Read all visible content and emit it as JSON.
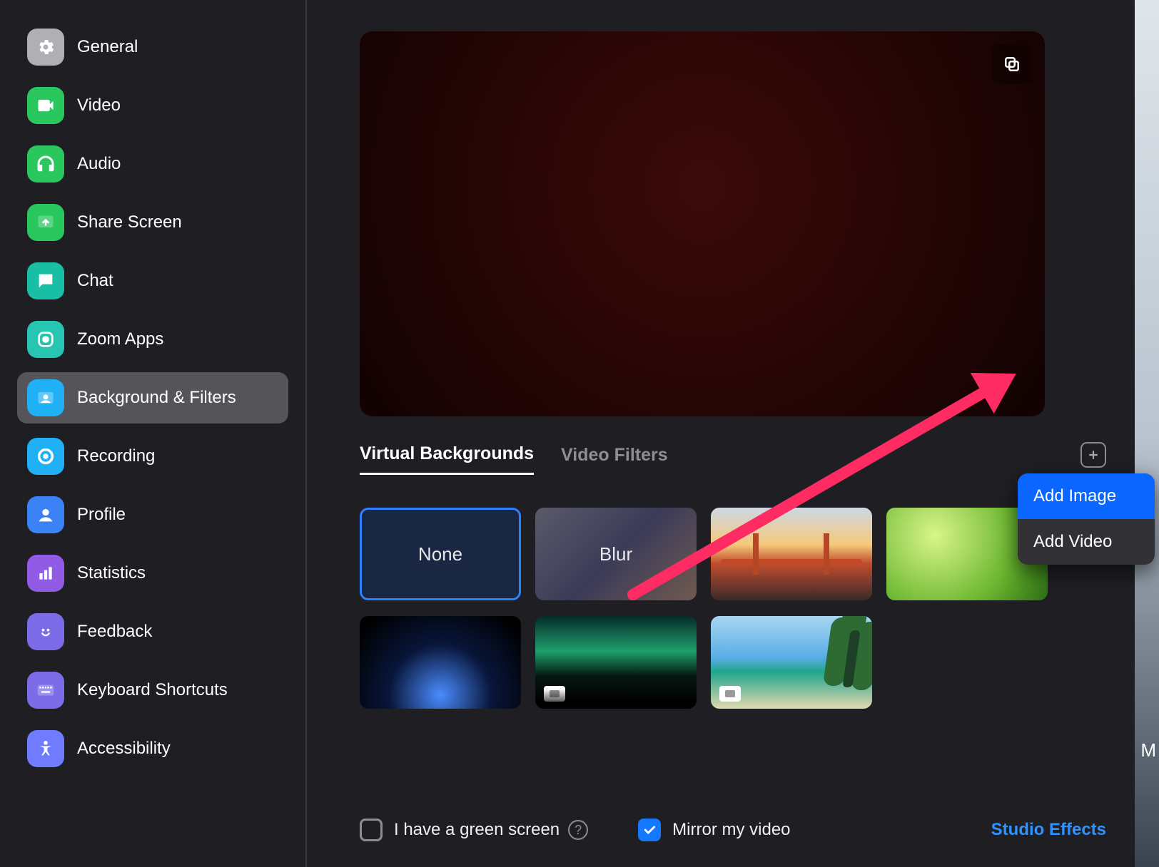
{
  "sidebar": {
    "items": [
      {
        "label": "General"
      },
      {
        "label": "Video"
      },
      {
        "label": "Audio"
      },
      {
        "label": "Share Screen"
      },
      {
        "label": "Chat"
      },
      {
        "label": "Zoom Apps"
      },
      {
        "label": "Background & Filters"
      },
      {
        "label": "Recording"
      },
      {
        "label": "Profile"
      },
      {
        "label": "Statistics"
      },
      {
        "label": "Feedback"
      },
      {
        "label": "Keyboard Shortcuts"
      },
      {
        "label": "Accessibility"
      }
    ],
    "active_index": 6
  },
  "tabs": {
    "virtual_backgrounds": "Virtual Backgrounds",
    "video_filters": "Video Filters",
    "active": "virtual_backgrounds"
  },
  "backgrounds": {
    "none_label": "None",
    "blur_label": "Blur",
    "selected_index": 0,
    "items": [
      "none",
      "blur",
      "bridge",
      "grass",
      "earth",
      "aurora",
      "beach"
    ]
  },
  "bottom": {
    "green_screen_label": "I have a green screen",
    "green_screen_checked": false,
    "mirror_label": "Mirror my video",
    "mirror_checked": true,
    "studio_effects": "Studio Effects"
  },
  "popup": {
    "add_image": "Add Image",
    "add_video": "Add Video",
    "highlighted": "add_image"
  },
  "desktop_char": "M"
}
